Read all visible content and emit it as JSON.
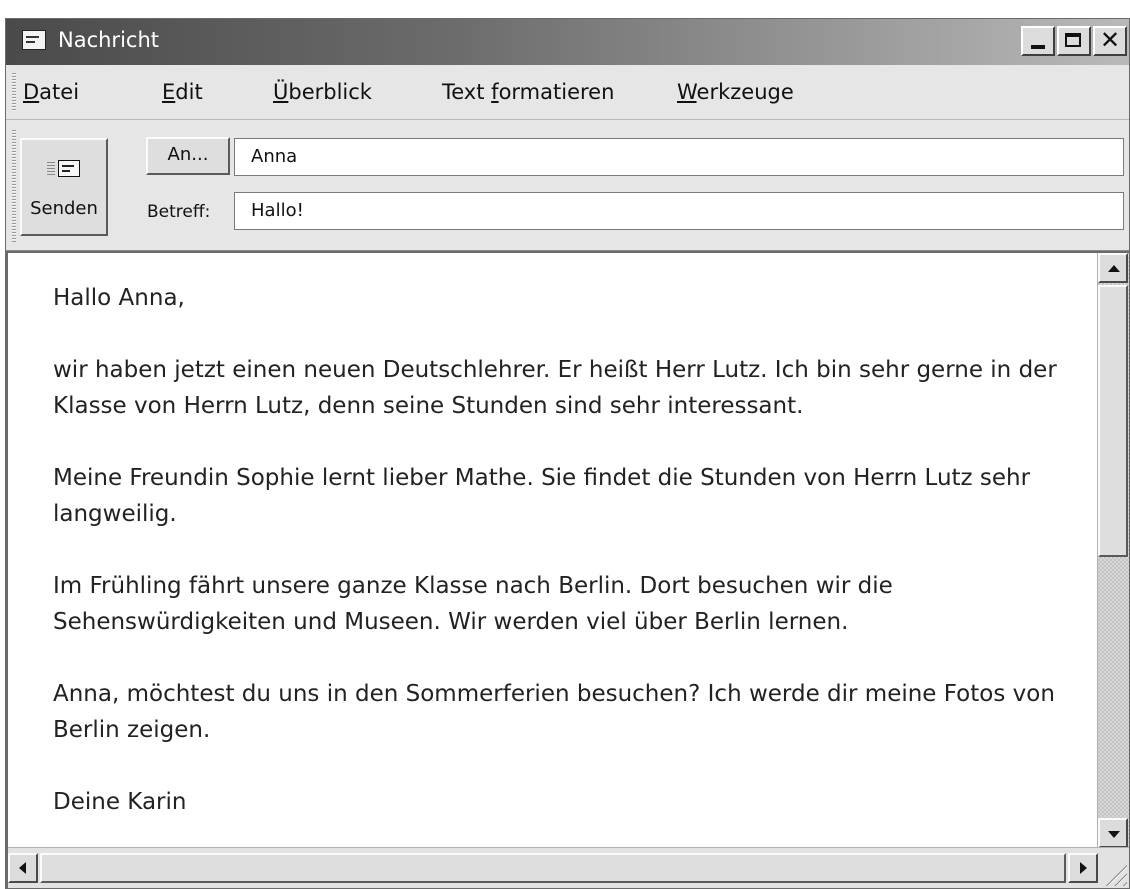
{
  "window": {
    "title": "Nachricht",
    "icon": "message-icon",
    "controls": [
      "minimize-icon",
      "maximize-icon",
      "close-icon"
    ]
  },
  "menu": {
    "items": [
      {
        "first": "D",
        "rest": "atei"
      },
      {
        "first": "E",
        "rest": "dit"
      },
      {
        "first": "Ü",
        "rest": "berblick"
      },
      {
        "label_before": "Text ",
        "underline": "f",
        "label_after": "ormatieren"
      },
      {
        "first": "W",
        "rest": "erkzeuge"
      }
    ]
  },
  "toolbar": {
    "send_label": "Senden",
    "send_icon": "send-mail-icon",
    "to_button_label": "An...",
    "to_value": "Anna",
    "subject_label": "Betreff:",
    "subject_value": "Hallo!"
  },
  "message": {
    "paragraphs": [
      "Hallo Anna,",
      "wir haben jetzt einen neuen Deutschlehrer. Er heißt Herr Lutz. Ich bin sehr gerne in der Klasse von Herrn Lutz, denn seine Stunden sind sehr interessant.",
      "Meine Freundin Sophie lernt lieber Mathe. Sie findet die Stunden von Herrn Lutz sehr langweilig.",
      "Im Frühling fährt unsere ganze Klasse nach Berlin. Dort besuchen wir die Sehenswürdigkeiten und Museen. Wir werden viel über Berlin lernen.",
      "Anna, möchtest du uns in den Sommerferien besuchen? Ich werde dir meine Fotos von Berlin zeigen.",
      "Deine Karin"
    ]
  },
  "scrollbars": {
    "vertical": {
      "up_icon": "scroll-up-arrow-icon",
      "down_icon": "scroll-down-arrow-icon"
    },
    "horizontal": {
      "left_icon": "scroll-left-arrow-icon",
      "right_icon": "scroll-right-arrow-icon"
    }
  }
}
